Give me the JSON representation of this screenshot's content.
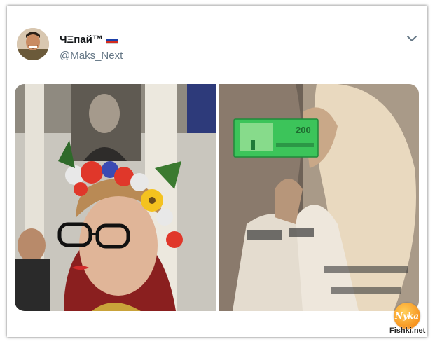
{
  "tweet": {
    "display_name": "ЧΞпай™",
    "handle": "@Maks_Next",
    "flag_icon": "russia-flag-icon",
    "menu_icon": "chevron-down-icon"
  },
  "media": {
    "left_photo": "woman-with-flower-wreath-photo",
    "right_photo": "couple-kissing-photo",
    "banknote_value": "200"
  },
  "watermark": {
    "logo_text": "Nyka",
    "site_text": "Fishki.net"
  },
  "colors": {
    "banknote_green": "#3cc45a",
    "handle_gray": "#657786",
    "logo_orange": "#f7931e"
  }
}
